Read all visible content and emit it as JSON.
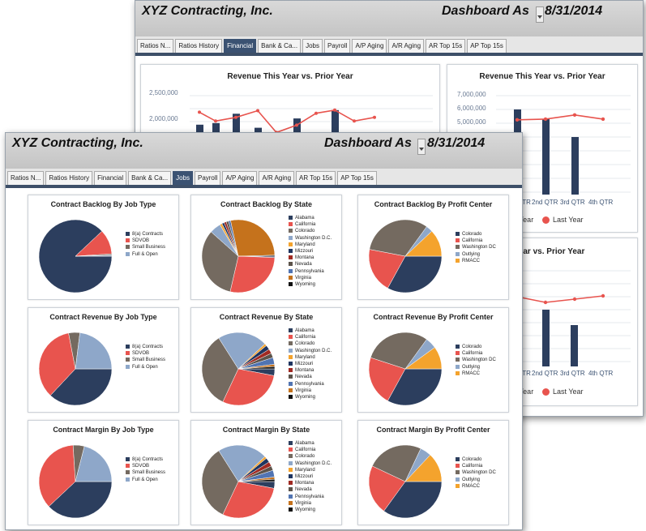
{
  "back_window": {
    "company": "XYZ Contracting, Inc.",
    "asof_label": "Dashboard As",
    "asof_date": "8/31/2014",
    "tabs": [
      "Ratios N...",
      "Ratios History",
      "Financial",
      "Bank & Ca...",
      "Jobs",
      "Payroll",
      "A/P Aging",
      "A/R Aging",
      "AR Top 15s",
      "AP Top 15s"
    ],
    "active_tab": "Financial",
    "chart1": {
      "title": "Revenue This Year vs. Prior Year",
      "yticks": [
        "2,500,000",
        "2,000,000"
      ]
    },
    "chart2": {
      "title": "Revenue This Year vs. Prior Year",
      "yticks": [
        "7,000,000",
        "6,000,000",
        "5,000,000"
      ],
      "xticks": [
        "QTR",
        "2nd QTR",
        "3rd QTR",
        "4th QTR"
      ],
      "legend_this": "Year",
      "legend_last": "Last Year"
    },
    "chart3": {
      "title": "his Year vs. Prior Year",
      "xticks": [
        "QTR",
        "2nd QTR",
        "3rd QTR",
        "4th QTR"
      ],
      "legend_this": "Year",
      "legend_last": "Last Year"
    }
  },
  "front_window": {
    "company": "XYZ Contracting, Inc.",
    "asof_label": "Dashboard As",
    "asof_date": "8/31/2014",
    "tabs": [
      "Ratios N...",
      "Ratios History",
      "Financial",
      "Bank & Ca...",
      "Jobs",
      "Payroll",
      "A/P Aging",
      "A/R Aging",
      "AR Top 15s",
      "AP Top 15s"
    ],
    "active_tab": "Jobs"
  },
  "colors": {
    "navy": "#2c3e5e",
    "red": "#e8544e",
    "taupe": "#746a60",
    "steel": "#8ea7c9",
    "orange": "#f4a32d",
    "brown": "#c5721c",
    "blue": "#5174b2",
    "darkred": "#a02a22",
    "black": "#111111",
    "line_red": "#e8544e",
    "bar_navy": "#2c3e5e"
  },
  "chart_data": [
    {
      "type": "pie",
      "title": "Contract Backlog By Job Type",
      "labels": [
        "8(a) Contracts",
        "SDVOB",
        "Small Business",
        "Full & Open"
      ],
      "colors": [
        "#2c3e5e",
        "#e8544e",
        "#746a60",
        "#8ea7c9"
      ],
      "values": [
        88,
        11,
        0.6,
        0.4
      ],
      "legend_position": "right"
    },
    {
      "type": "pie",
      "title": "Contract Backlog By State",
      "labels": [
        "Alabama",
        "California",
        "Colorado",
        "Washington D.C.",
        "Maryland",
        "Mizzouri",
        "Montana",
        "Nevada",
        "Pennsylvania",
        "Virginia",
        "Wyoming"
      ],
      "colors": [
        "#2c3e5e",
        "#e8544e",
        "#746a60",
        "#8ea7c9",
        "#f4a32d",
        "#1f3560",
        "#a02a22",
        "#5c534a",
        "#5174b2",
        "#c5721c",
        "#111111"
      ],
      "values": [
        0.6,
        28,
        33,
        5,
        1,
        1,
        1,
        1,
        1,
        28,
        0.4
      ],
      "legend_position": "right"
    },
    {
      "type": "pie",
      "title": "Contract Backlog By Profit Center",
      "labels": [
        "Colorado",
        "California",
        "Washington DC",
        "Outlying",
        "RMACC"
      ],
      "colors": [
        "#2c3e5e",
        "#e8544e",
        "#746a60",
        "#8ea7c9",
        "#f4a32d"
      ],
      "values": [
        33,
        20,
        32,
        3,
        12
      ],
      "legend_position": "right"
    },
    {
      "type": "pie",
      "title": "Contract Revenue By Job Type",
      "labels": [
        "8(a) Contracts",
        "SDVOB",
        "Small Business",
        "Full & Open"
      ],
      "colors": [
        "#2c3e5e",
        "#e8544e",
        "#746a60",
        "#8ea7c9"
      ],
      "values": [
        37,
        35,
        5,
        23
      ],
      "legend_position": "right"
    },
    {
      "type": "pie",
      "title": "Contract Revenue By State",
      "labels": [
        "Alabama",
        "California",
        "Colorado",
        "Washington D.C.",
        "Maryland",
        "Mizzouri",
        "Montana",
        "Nevada",
        "Pennsylvania",
        "Virginia",
        "Wyoming"
      ],
      "colors": [
        "#2c3e5e",
        "#e8544e",
        "#746a60",
        "#8ea7c9",
        "#f4a32d",
        "#1f3560",
        "#a02a22",
        "#5c534a",
        "#5174b2",
        "#c5721c",
        "#111111"
      ],
      "values": [
        3,
        29,
        34,
        22,
        1,
        2,
        2,
        2,
        3,
        1,
        1
      ],
      "legend_position": "right"
    },
    {
      "type": "pie",
      "title": "Contract Revenue By Profit Center",
      "labels": [
        "Colorado",
        "California",
        "Washington DC",
        "Outlying",
        "RMACC"
      ],
      "colors": [
        "#2c3e5e",
        "#e8544e",
        "#746a60",
        "#8ea7c9",
        "#f4a32d"
      ],
      "values": [
        33,
        22,
        30,
        5,
        10
      ],
      "legend_position": "right"
    },
    {
      "type": "pie",
      "title": "Contract Margin By Job Type",
      "labels": [
        "8(a) Contracts",
        "SDVOB",
        "Small Business",
        "Full & Open"
      ],
      "colors": [
        "#2c3e5e",
        "#e8544e",
        "#746a60",
        "#8ea7c9"
      ],
      "values": [
        38,
        36,
        5,
        21
      ],
      "legend_position": "right"
    },
    {
      "type": "pie",
      "title": "Contract Margin By State",
      "labels": [
        "Alabama",
        "California",
        "Colorado",
        "Washington D.C.",
        "Maryland",
        "Mizzouri",
        "Montana",
        "Nevada",
        "Pennsylvania",
        "Virginia",
        "Wyoming"
      ],
      "colors": [
        "#2c3e5e",
        "#e8544e",
        "#746a60",
        "#8ea7c9",
        "#f4a32d",
        "#1f3560",
        "#a02a22",
        "#5c534a",
        "#5174b2",
        "#c5721c",
        "#111111"
      ],
      "values": [
        3,
        29,
        34,
        22,
        1,
        2,
        2,
        2,
        3,
        1,
        1
      ],
      "legend_position": "right"
    },
    {
      "type": "pie",
      "title": "Contract Margin By Profit Center",
      "labels": [
        "Colorado",
        "California",
        "Washington DC",
        "Outlying",
        "RMACC"
      ],
      "colors": [
        "#2c3e5e",
        "#e8544e",
        "#746a60",
        "#8ea7c9",
        "#f4a32d"
      ],
      "values": [
        35,
        22,
        25,
        5,
        13
      ],
      "legend_position": "right"
    },
    {
      "type": "bar",
      "title": "Revenue This Year vs. Prior Year",
      "ylim": [
        1700000,
        2700000
      ],
      "bars": [
        1910000,
        1940000,
        2120000,
        1850000,
        2030000,
        2190000
      ],
      "line": [
        2150000,
        1980000,
        2050000,
        2180000,
        1760000,
        1900000,
        2130000,
        2190000,
        1980000,
        2050000
      ],
      "legend_position": "none"
    },
    {
      "type": "bar",
      "title": "Revenue This Year vs. Prior Year",
      "categories": [
        "QTR",
        "2nd QTR",
        "3rd QTR",
        "4th QTR"
      ],
      "ylim": [
        0,
        7000000
      ],
      "series": [
        {
          "name": "Year",
          "values": [
            6000000,
            5300000,
            4000000,
            null
          ]
        },
        {
          "name": "Last Year",
          "values": [
            5250000,
            5300000,
            5600000,
            5300000
          ]
        }
      ],
      "legend_position": "bottom"
    }
  ]
}
